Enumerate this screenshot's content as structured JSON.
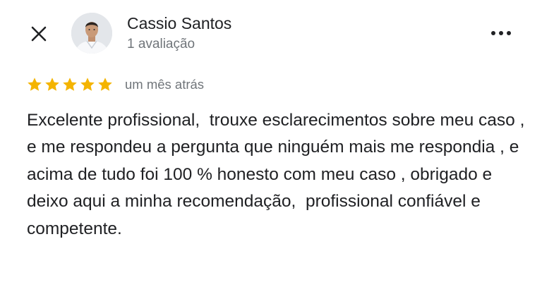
{
  "reviewer": {
    "name": "Cassio Santos",
    "review_count": "1 avaliação"
  },
  "rating": {
    "stars": 5,
    "max_stars": 5,
    "star_color": "#f4b400"
  },
  "date": "um mês atrás",
  "review_text": "Excelente profissional,  trouxe esclarecimentos sobre meu caso , e me respondeu a pergunta que ninguém mais me respondia , e acima de tudo foi 100 % honesto com meu caso , obrigado e deixo aqui a minha recomendação,  profissional confiável e competente.",
  "icons": {
    "close": "close-icon",
    "more": "more-options-icon"
  }
}
